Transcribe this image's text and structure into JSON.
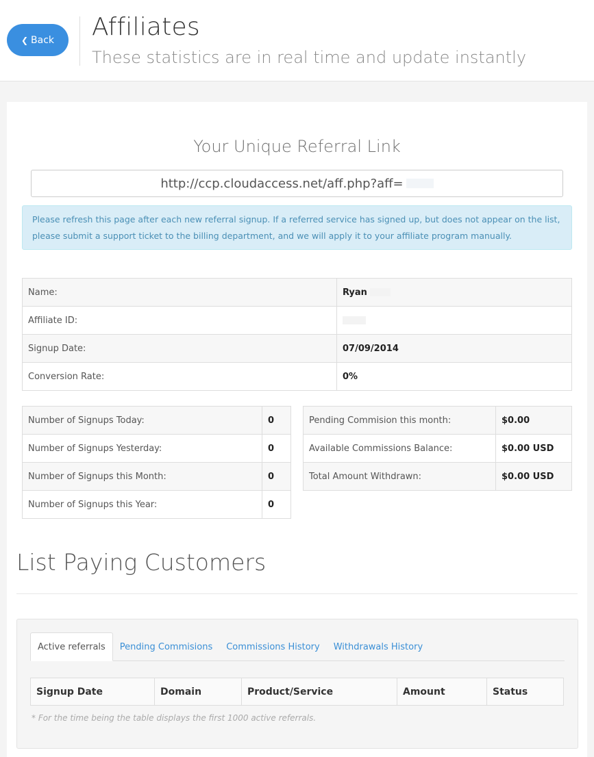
{
  "header": {
    "back_label": "Back",
    "title": "Affiliates",
    "subtitle": "These statistics are in real time and update instantly"
  },
  "referral": {
    "heading": "Your Unique Referral Link",
    "link": "http://ccp.cloudaccess.net/aff.php?aff="
  },
  "alert": {
    "text": "Please refresh this page after each new referral signup. If a referred service has signed up, but does not appear on the list, please submit a support ticket to the billing department, and we will apply it to your affiliate program manually."
  },
  "info": {
    "rows": [
      {
        "label": "Name:",
        "value": "Ryan"
      },
      {
        "label": "Affiliate ID:",
        "value": ""
      },
      {
        "label": "Signup Date:",
        "value": "07/09/2014"
      },
      {
        "label": "Conversion Rate:",
        "value": "0%"
      }
    ]
  },
  "signups": {
    "rows": [
      {
        "label": "Number of Signups Today:",
        "value": "0"
      },
      {
        "label": "Number of Signups Yesterday:",
        "value": "0"
      },
      {
        "label": "Number of Signups this Month:",
        "value": "0"
      },
      {
        "label": "Number of Signups this Year:",
        "value": "0"
      }
    ]
  },
  "commissions": {
    "rows": [
      {
        "label": "Pending Commision this month:",
        "value": "$0.00"
      },
      {
        "label": "Available Commissions Balance:",
        "value": "$0.00 USD"
      },
      {
        "label": "Total Amount Withdrawn:",
        "value": "$0.00 USD"
      }
    ]
  },
  "customers": {
    "title": "List Paying Customers",
    "tabs": [
      {
        "label": "Active referrals",
        "active": true
      },
      {
        "label": "Pending Commisions",
        "active": false
      },
      {
        "label": "Commissions History",
        "active": false
      },
      {
        "label": "Withdrawals History",
        "active": false
      }
    ],
    "columns": [
      "Signup Date",
      "Domain",
      "Product/Service",
      "Amount",
      "Status"
    ],
    "note": "* For the time being the table displays the first 1000 active referrals."
  },
  "colors": {
    "accent": "#3a8fe0",
    "alert_bg": "#d9edf7",
    "alert_text": "#4a8fb5"
  }
}
